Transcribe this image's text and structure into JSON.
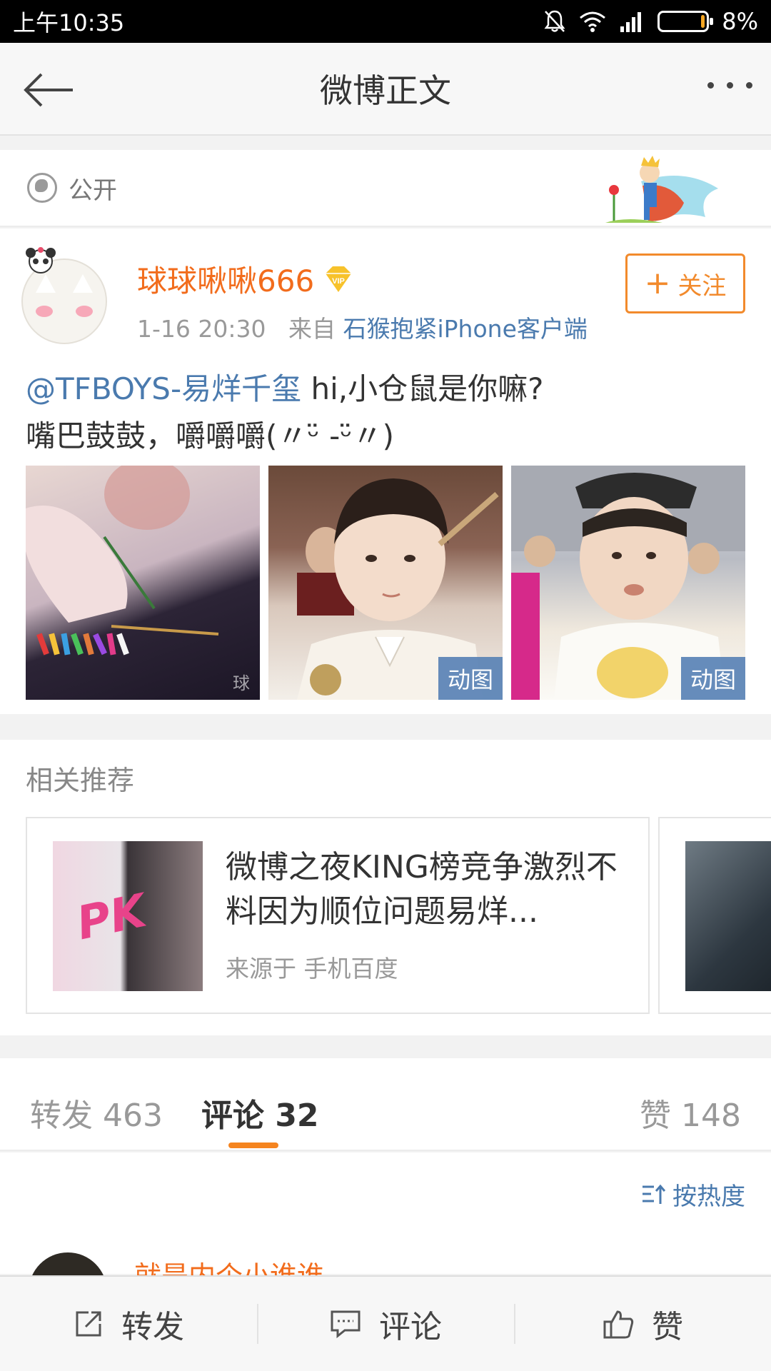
{
  "status_bar": {
    "time": "上午10:35",
    "battery": "8%",
    "battery_level": 0.08
  },
  "nav": {
    "title": "微博正文"
  },
  "visibility": {
    "label": "公开"
  },
  "post": {
    "username": "球球啾啾666",
    "time": "1-16 20:30",
    "from_label": "来自",
    "source": "石猴抱紧iPhone客户端",
    "follow_label": "关注",
    "mention": "@TFBOYS-易烊千玺",
    "text_line1": " hi,小仓鼠是你嘛?",
    "text_line2": "嘴巴鼓鼓，嚼嚼嚼(〃ᵕ̈ -ᵕ̈〃)",
    "images": [
      {
        "badge": "",
        "mark": "球"
      },
      {
        "badge": "动图",
        "mark": ""
      },
      {
        "badge": "动图",
        "mark": ""
      }
    ]
  },
  "related": {
    "title": "相关推荐",
    "card": {
      "title": "微博之夜KING榜竞争激烈不料因为顺位问题易烊...",
      "source": "来源于 手机百度",
      "image_text": "PK"
    }
  },
  "tabs": {
    "repost": "转发 463",
    "comment": "评论 32",
    "like": "赞 148"
  },
  "sort": {
    "label": "按热度"
  },
  "comment": {
    "username": "就是内个小谁谁"
  },
  "bottom": {
    "repost": "转发",
    "comment": "评论",
    "like": "赞"
  },
  "colors": {
    "accent": "#f26c1c",
    "link": "#4a7aae",
    "tab_underline": "#f5841f"
  }
}
